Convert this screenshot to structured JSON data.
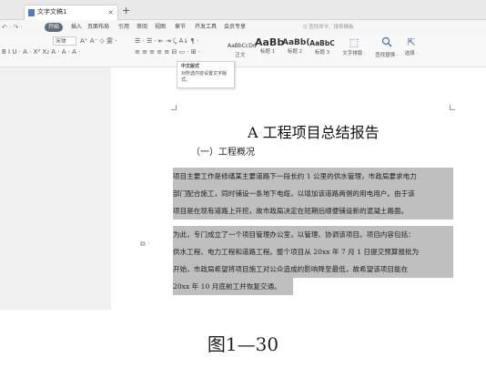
{
  "window": {
    "tab_title": "文字文稿1",
    "tab_close": "×",
    "new_tab": "+"
  },
  "menu": {
    "undo_group": "↶ · ↷ ·",
    "start": "开始",
    "items": [
      "插入",
      "页面布局",
      "引用",
      "审阅",
      "视图",
      "章节",
      "开发工具",
      "会员专享"
    ],
    "search_placeholder": "Q 查找命令、搜索模板"
  },
  "ribbon": {
    "font_name": "宋体",
    "font_size_controls": "A⁺ A⁻ ◇ 雯 ·",
    "format_row": "B I U · A · X² X₂ A · A · A ·",
    "para_row1": "☰ · ☰ · ⇤ ⇥ ⤹ A↓ ¶ ·",
    "para_row2": "≡ ≡ ≡ ≡ ≡ ⊟ ▭ · ⊞ ·",
    "styles": [
      {
        "sample": "AaBbCcDd",
        "label": "正文"
      },
      {
        "sample": "AaBb",
        "label": "标题 1"
      },
      {
        "sample": "AaBb(",
        "label": "标题 2"
      },
      {
        "sample": "AaBbC",
        "label": "标题 3"
      }
    ],
    "tools": [
      {
        "icon": "text-layout-icon",
        "glyph": "⬚",
        "label": "文字排版 ·"
      },
      {
        "icon": "find-replace-icon",
        "glyph": "🔍",
        "label": "查找替换 ·"
      },
      {
        "icon": "select-icon",
        "glyph": "⇱",
        "label": "选择 ·"
      }
    ]
  },
  "tooltip": {
    "title": "中文版式",
    "body": "对所选内容设置文字版式。"
  },
  "document": {
    "title": "A 工程项目总结报告",
    "heading1": "（一）工程概况",
    "paragraph1": [
      "项目主要工作是修缮某主要道路下一段长约 1 公里的供水管理，市政局要求电力",
      "部门配合施工，同时铺设一条地下电缆，以增加该道路两侧的用电用户。由于该",
      "项目是在现有道路上开挖，故市政局决定在短期后顺便铺设新的混凝土路面。"
    ],
    "paragraph2": [
      "为此，专门成立了一个项目管理办公室，以管理、协调该项目。项目内容包括：",
      "供水工程、电力工程和道路工程。整个项目从 20xx 年 7 月 1 日提交预算报批为",
      "开始，市政局希望将项目施工对公众造成的影响降至最低，故希望该项目能在",
      "20xx 年 10 月底前工并恢复交通。"
    ]
  },
  "caption": "图1—30"
}
